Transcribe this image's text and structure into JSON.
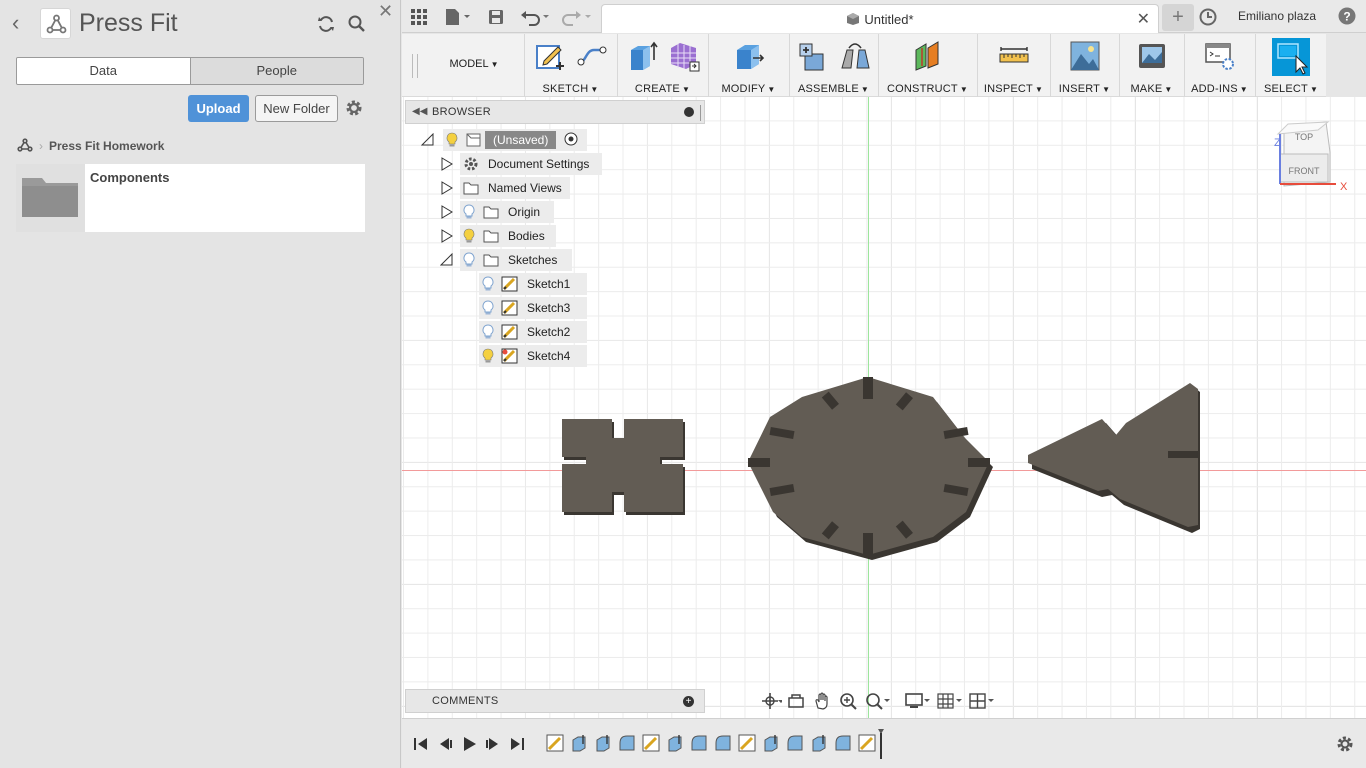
{
  "left_panel": {
    "title": "Press Fit",
    "tabs": [
      {
        "label": "Data"
      },
      {
        "label": "People"
      }
    ],
    "upload_label": "Upload",
    "new_folder_label": "New Folder",
    "breadcrumb": "Press Fit Homework",
    "folder_name": "Components"
  },
  "appbar": {
    "doc_title": "Untitled*",
    "user": "Emiliano plaza",
    "help": "?"
  },
  "ribbon": {
    "mode": "MODEL",
    "groups": [
      {
        "label": "SKETCH"
      },
      {
        "label": "CREATE"
      },
      {
        "label": "MODIFY"
      },
      {
        "label": "ASSEMBLE"
      },
      {
        "label": "CONSTRUCT"
      },
      {
        "label": "INSPECT"
      },
      {
        "label": "INSERT"
      },
      {
        "label": "MAKE"
      },
      {
        "label": "ADD-INS"
      },
      {
        "label": "SELECT"
      }
    ]
  },
  "browser": {
    "title": "BROWSER",
    "root": "(Unsaved)",
    "items": [
      {
        "label": "Document Settings"
      },
      {
        "label": "Named Views"
      },
      {
        "label": "Origin"
      },
      {
        "label": "Bodies"
      },
      {
        "label": "Sketches"
      }
    ],
    "sketches": [
      {
        "label": "Sketch1"
      },
      {
        "label": "Sketch3"
      },
      {
        "label": "Sketch2"
      },
      {
        "label": "Sketch4"
      }
    ]
  },
  "comments": {
    "title": "COMMENTS"
  },
  "viewcube": {
    "top": "TOP",
    "front": "FRONT",
    "z": "Z",
    "x": "X"
  },
  "colors": {
    "accent": "#4f92d8",
    "body": "#625c54",
    "body_side": "#3a3631",
    "select_blue": "#0696d7",
    "bulb_yellow": "#f4d03f",
    "bulb_blue": "#a8c6e8"
  }
}
